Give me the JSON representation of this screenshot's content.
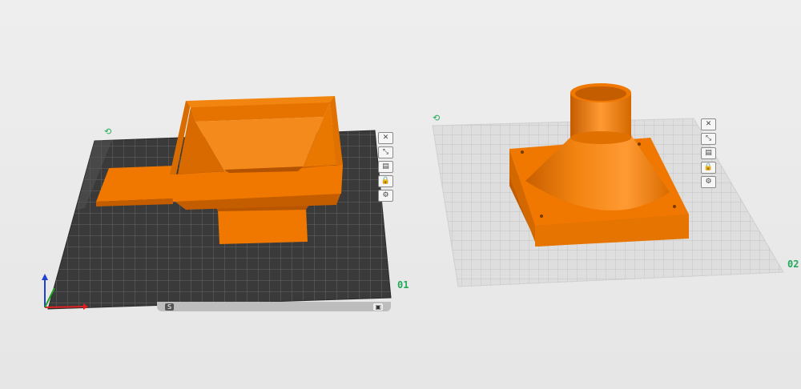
{
  "plates": [
    {
      "label": "01",
      "theme": "dark"
    },
    {
      "label": "02",
      "theme": "light"
    }
  ],
  "plate_icon_glyph": "⟲",
  "plate_tools": [
    {
      "icon": "close-icon",
      "glyph": "✕"
    },
    {
      "icon": "arrange-icon",
      "glyph": "⤡"
    },
    {
      "icon": "orient-icon",
      "glyph": "▤"
    },
    {
      "icon": "lock-icon",
      "glyph": "🔒"
    },
    {
      "icon": "settings-icon",
      "glyph": "⚙"
    }
  ],
  "strip": {
    "badge": "S",
    "icon": "▣"
  },
  "colors": {
    "model": "#f07800",
    "model_dark": "#c45d00",
    "model_light": "#ff9a33",
    "plate_dark": "#3a3a3a",
    "plate_light": "#dcdcdc",
    "accent": "#1faa59",
    "axis_x": "#e02020",
    "axis_y": "#20a020",
    "axis_z": "#2040d0"
  }
}
